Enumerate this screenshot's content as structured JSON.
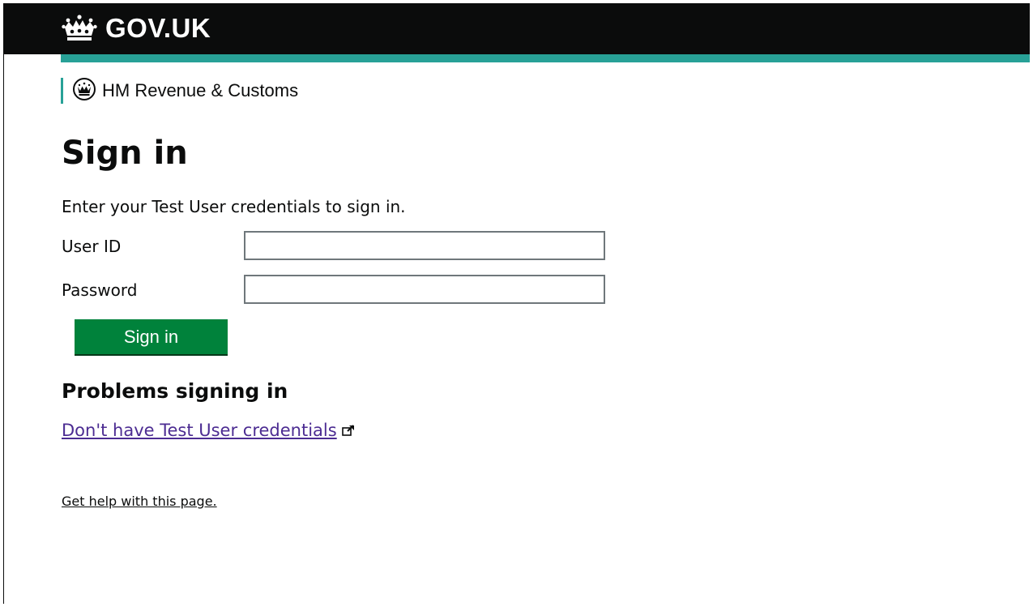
{
  "header": {
    "site_name": "GOV.UK",
    "department": "HM Revenue & Customs"
  },
  "page": {
    "title": "Sign in",
    "intro": "Enter your Test User credentials to sign in."
  },
  "form": {
    "user_id_label": "User ID",
    "user_id_value": "",
    "password_label": "Password",
    "password_value": "",
    "submit_label": "Sign in"
  },
  "help": {
    "heading": "Problems signing in",
    "no_credentials_link": "Don't have Test User credentials",
    "get_help_link": "Get help with this page."
  },
  "colors": {
    "header_bg": "#0b0c0c",
    "accent_teal": "#28a197",
    "button_green": "#00823b",
    "link_purple": "#4c2c92"
  },
  "icons": {
    "logo": "crown-icon",
    "department": "hmrc-crest-icon",
    "external_link": "external-link-icon"
  }
}
